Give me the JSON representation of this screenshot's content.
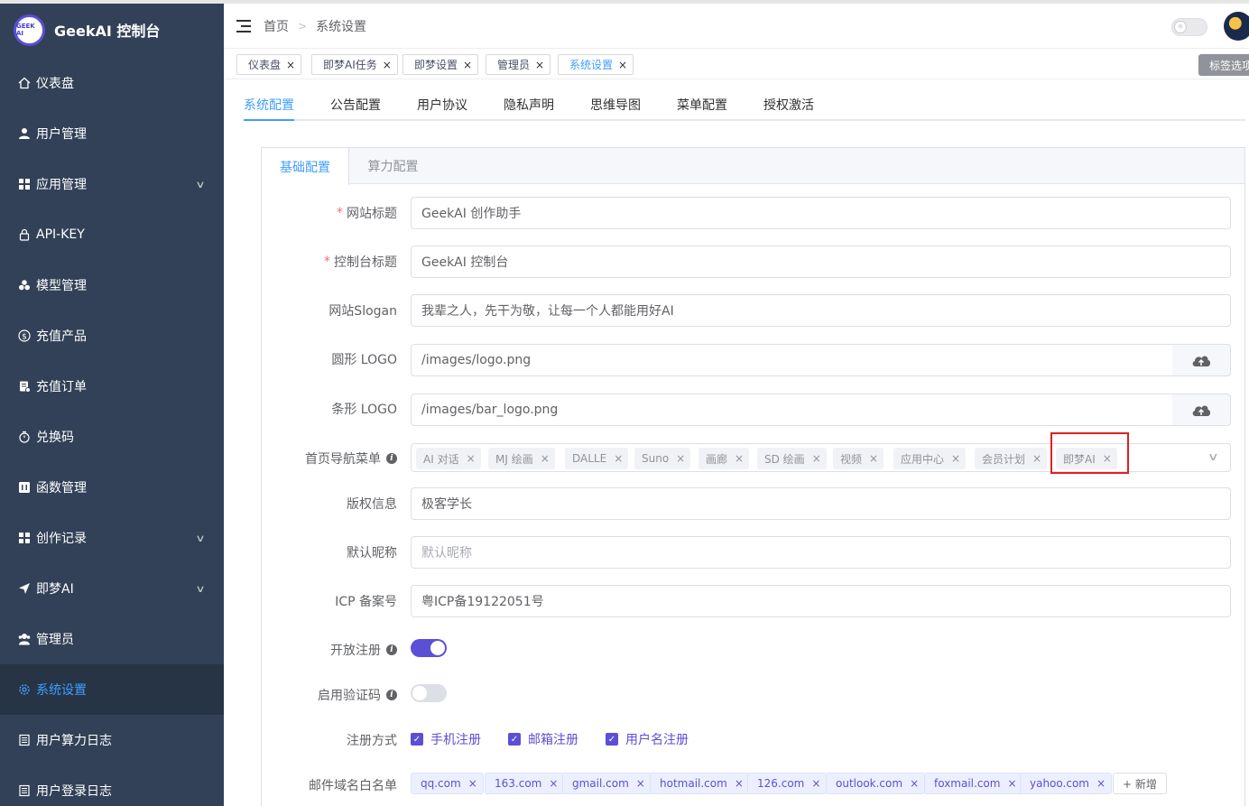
{
  "sidebar": {
    "brand_logo_text": "GEEK AI",
    "brand_title": "GeekAI 控制台",
    "items": [
      {
        "label": "仪表盘",
        "icon": "home-icon"
      },
      {
        "label": "用户管理",
        "icon": "user-icon"
      },
      {
        "label": "应用管理",
        "icon": "grid-icon",
        "expandable": true
      },
      {
        "label": "API-KEY",
        "icon": "lock-icon"
      },
      {
        "label": "模型管理",
        "icon": "cubes-icon"
      },
      {
        "label": "充值产品",
        "icon": "dollar-icon"
      },
      {
        "label": "充值订单",
        "icon": "order-icon"
      },
      {
        "label": "兑换码",
        "icon": "timer-icon"
      },
      {
        "label": "函数管理",
        "icon": "function-icon"
      },
      {
        "label": "创作记录",
        "icon": "grid-icon",
        "expandable": true
      },
      {
        "label": "即梦AI",
        "icon": "send-icon",
        "expandable": true
      },
      {
        "label": "管理员",
        "icon": "admin-icon"
      },
      {
        "label": "系统设置",
        "icon": "gear-icon",
        "active": true
      },
      {
        "label": "用户算力日志",
        "icon": "document-icon"
      },
      {
        "label": "用户登录日志",
        "icon": "document-icon"
      }
    ]
  },
  "header": {
    "breadcrumb": [
      "首页",
      "系统设置"
    ]
  },
  "tags_bar": {
    "tags": [
      {
        "label": "仪表盘"
      },
      {
        "label": "即梦AI任务"
      },
      {
        "label": "即梦设置"
      },
      {
        "label": "管理员"
      },
      {
        "label": "系统设置",
        "active": true
      }
    ],
    "options_label": "标签选项"
  },
  "main_tabs": [
    "系统配置",
    "公告配置",
    "用户协议",
    "隐私声明",
    "思维导图",
    "菜单配置",
    "授权激活"
  ],
  "card_tabs": [
    "基础配置",
    "算力配置"
  ],
  "form": {
    "site_title": {
      "label": "网站标题",
      "value": "GeekAI 创作助手"
    },
    "console_title": {
      "label": "控制台标题",
      "value": "GeekAI 控制台"
    },
    "slogan": {
      "label": "网站Slogan",
      "value": "我辈之人，先干为敬，让每一个人都能用好AI"
    },
    "round_logo": {
      "label": "圆形 LOGO",
      "value": "/images/logo.png"
    },
    "bar_logo": {
      "label": "条形 LOGO",
      "value": "/images/bar_logo.png"
    },
    "nav_menu": {
      "label": "首页导航菜单",
      "tags": [
        "AI 对话",
        "MJ 绘画",
        "DALLE",
        "Suno",
        "画廊",
        "SD 绘画",
        "视频",
        "应用中心",
        "会员计划",
        "即梦AI"
      ]
    },
    "copyright": {
      "label": "版权信息",
      "value": "极客学长"
    },
    "default_nickname": {
      "label": "默认昵称",
      "placeholder": "默认昵称"
    },
    "icp": {
      "label": "ICP 备案号",
      "value": "粤ICP备19122051号"
    },
    "open_register": {
      "label": "开放注册",
      "enabled": true
    },
    "captcha": {
      "label": "启用验证码",
      "enabled": false
    },
    "register_methods": {
      "label": "注册方式",
      "options": [
        "手机注册",
        "邮箱注册",
        "用户名注册"
      ]
    },
    "email_whitelist": {
      "label": "邮件域名白名单",
      "domains": [
        "qq.com",
        "163.com",
        "gmail.com",
        "hotmail.com",
        "126.com",
        "outlook.com",
        "foxmail.com",
        "yahoo.com"
      ],
      "add_label": "+ 新增"
    }
  },
  "colors": {
    "sidebar_bg": "#324157",
    "accent": "#409eff",
    "primary": "#5b4fd6",
    "highlight_border": "#e02020"
  }
}
